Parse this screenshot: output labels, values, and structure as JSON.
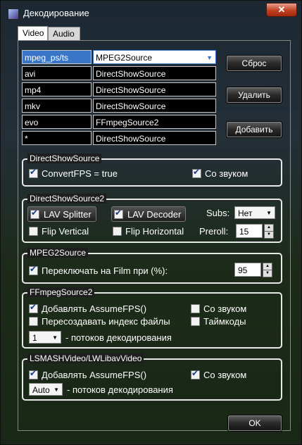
{
  "window": {
    "title": "Декодирование",
    "close_glyph": "✕"
  },
  "tabs": [
    {
      "label": "Video",
      "active": true
    },
    {
      "label": "Audio",
      "active": false
    }
  ],
  "grid": [
    {
      "name": "mpeg_ps/ts",
      "value": "MPEG2Source",
      "selected": true
    },
    {
      "name": "avi",
      "value": "DirectShowSource"
    },
    {
      "name": "mp4",
      "value": "DirectShowSource"
    },
    {
      "name": "mkv",
      "value": "DirectShowSource"
    },
    {
      "name": "evo",
      "value": "FFmpegSource2"
    },
    {
      "name": "*",
      "value": "DirectShowSource"
    }
  ],
  "actions": {
    "reset": "Сброс",
    "delete": "Удалить",
    "add": "Добавить",
    "ok": "OK"
  },
  "directshow": {
    "title": "DirectShowSource",
    "convert_fps": "ConvertFPS = true",
    "with_audio": "Со звуком"
  },
  "directshow2": {
    "title": "DirectShowSource2",
    "lav_splitter": "LAV Splitter",
    "lav_decoder": "LAV Decoder",
    "subs_label": "Subs:",
    "subs_value": "Нет",
    "flip_vertical": "Flip Vertical",
    "flip_horizontal": "Flip Horizontal",
    "preroll_label": "Preroll:",
    "preroll_value": "15"
  },
  "mpeg2": {
    "title": "MPEG2Source",
    "switch_film": "Переключать на Film при (%):",
    "film_value": "95"
  },
  "ffmpeg": {
    "title": "FFmpegSource2",
    "add_assumefps": "Добавлять AssumeFPS()",
    "with_audio": "Со звуком",
    "recreate_index": "Пересоздавать индекс файлы",
    "timecodes": "Таймкоды",
    "threads_value": "1",
    "threads_label": "- потоков декодирования"
  },
  "lsmash": {
    "title": "LSMASHVideo/LWLibavVideo",
    "add_assumefps": "Добавлять AssumeFPS()",
    "with_audio": "Со звуком",
    "threads_value": "Auto",
    "threads_label": "- потоков декодирования"
  }
}
